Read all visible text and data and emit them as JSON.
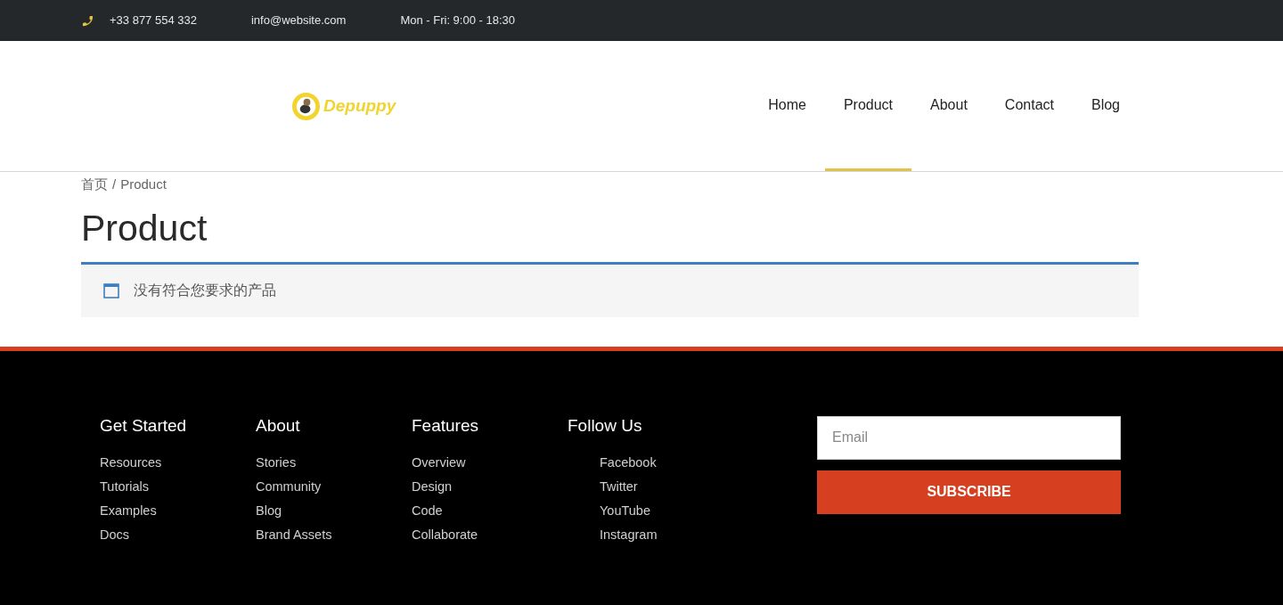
{
  "top_bar": {
    "phone": "+33 877 554 332",
    "email": "info@website.com",
    "hours": "Mon - Fri: 9:00 - 18:30"
  },
  "logo": {
    "text": "Depuppy"
  },
  "nav": [
    {
      "label": "Home",
      "selected": false
    },
    {
      "label": "Product",
      "selected": true
    },
    {
      "label": "About",
      "selected": false
    },
    {
      "label": "Contact",
      "selected": false
    },
    {
      "label": "Blog",
      "selected": false
    }
  ],
  "breadcrumb": {
    "home": "首页",
    "separator": "/",
    "current": "Product"
  },
  "page_title": "Product",
  "notice": "没有符合您要求的产品",
  "footer": {
    "columns": [
      {
        "title": "Get Started",
        "links": [
          "Resources",
          "Tutorials",
          "Examples",
          "Docs"
        ]
      },
      {
        "title": "About",
        "links": [
          "Stories",
          "Community",
          "Blog",
          "Brand Assets"
        ]
      },
      {
        "title": "Features",
        "links": [
          "Overview",
          "Design",
          "Code",
          "Collaborate"
        ]
      },
      {
        "title": "Follow Us",
        "links": [
          "Facebook",
          "Twitter",
          "YouTube",
          "Instagram"
        ]
      }
    ],
    "email_placeholder": "Email",
    "subscribe": "SUBSCRIBE"
  }
}
